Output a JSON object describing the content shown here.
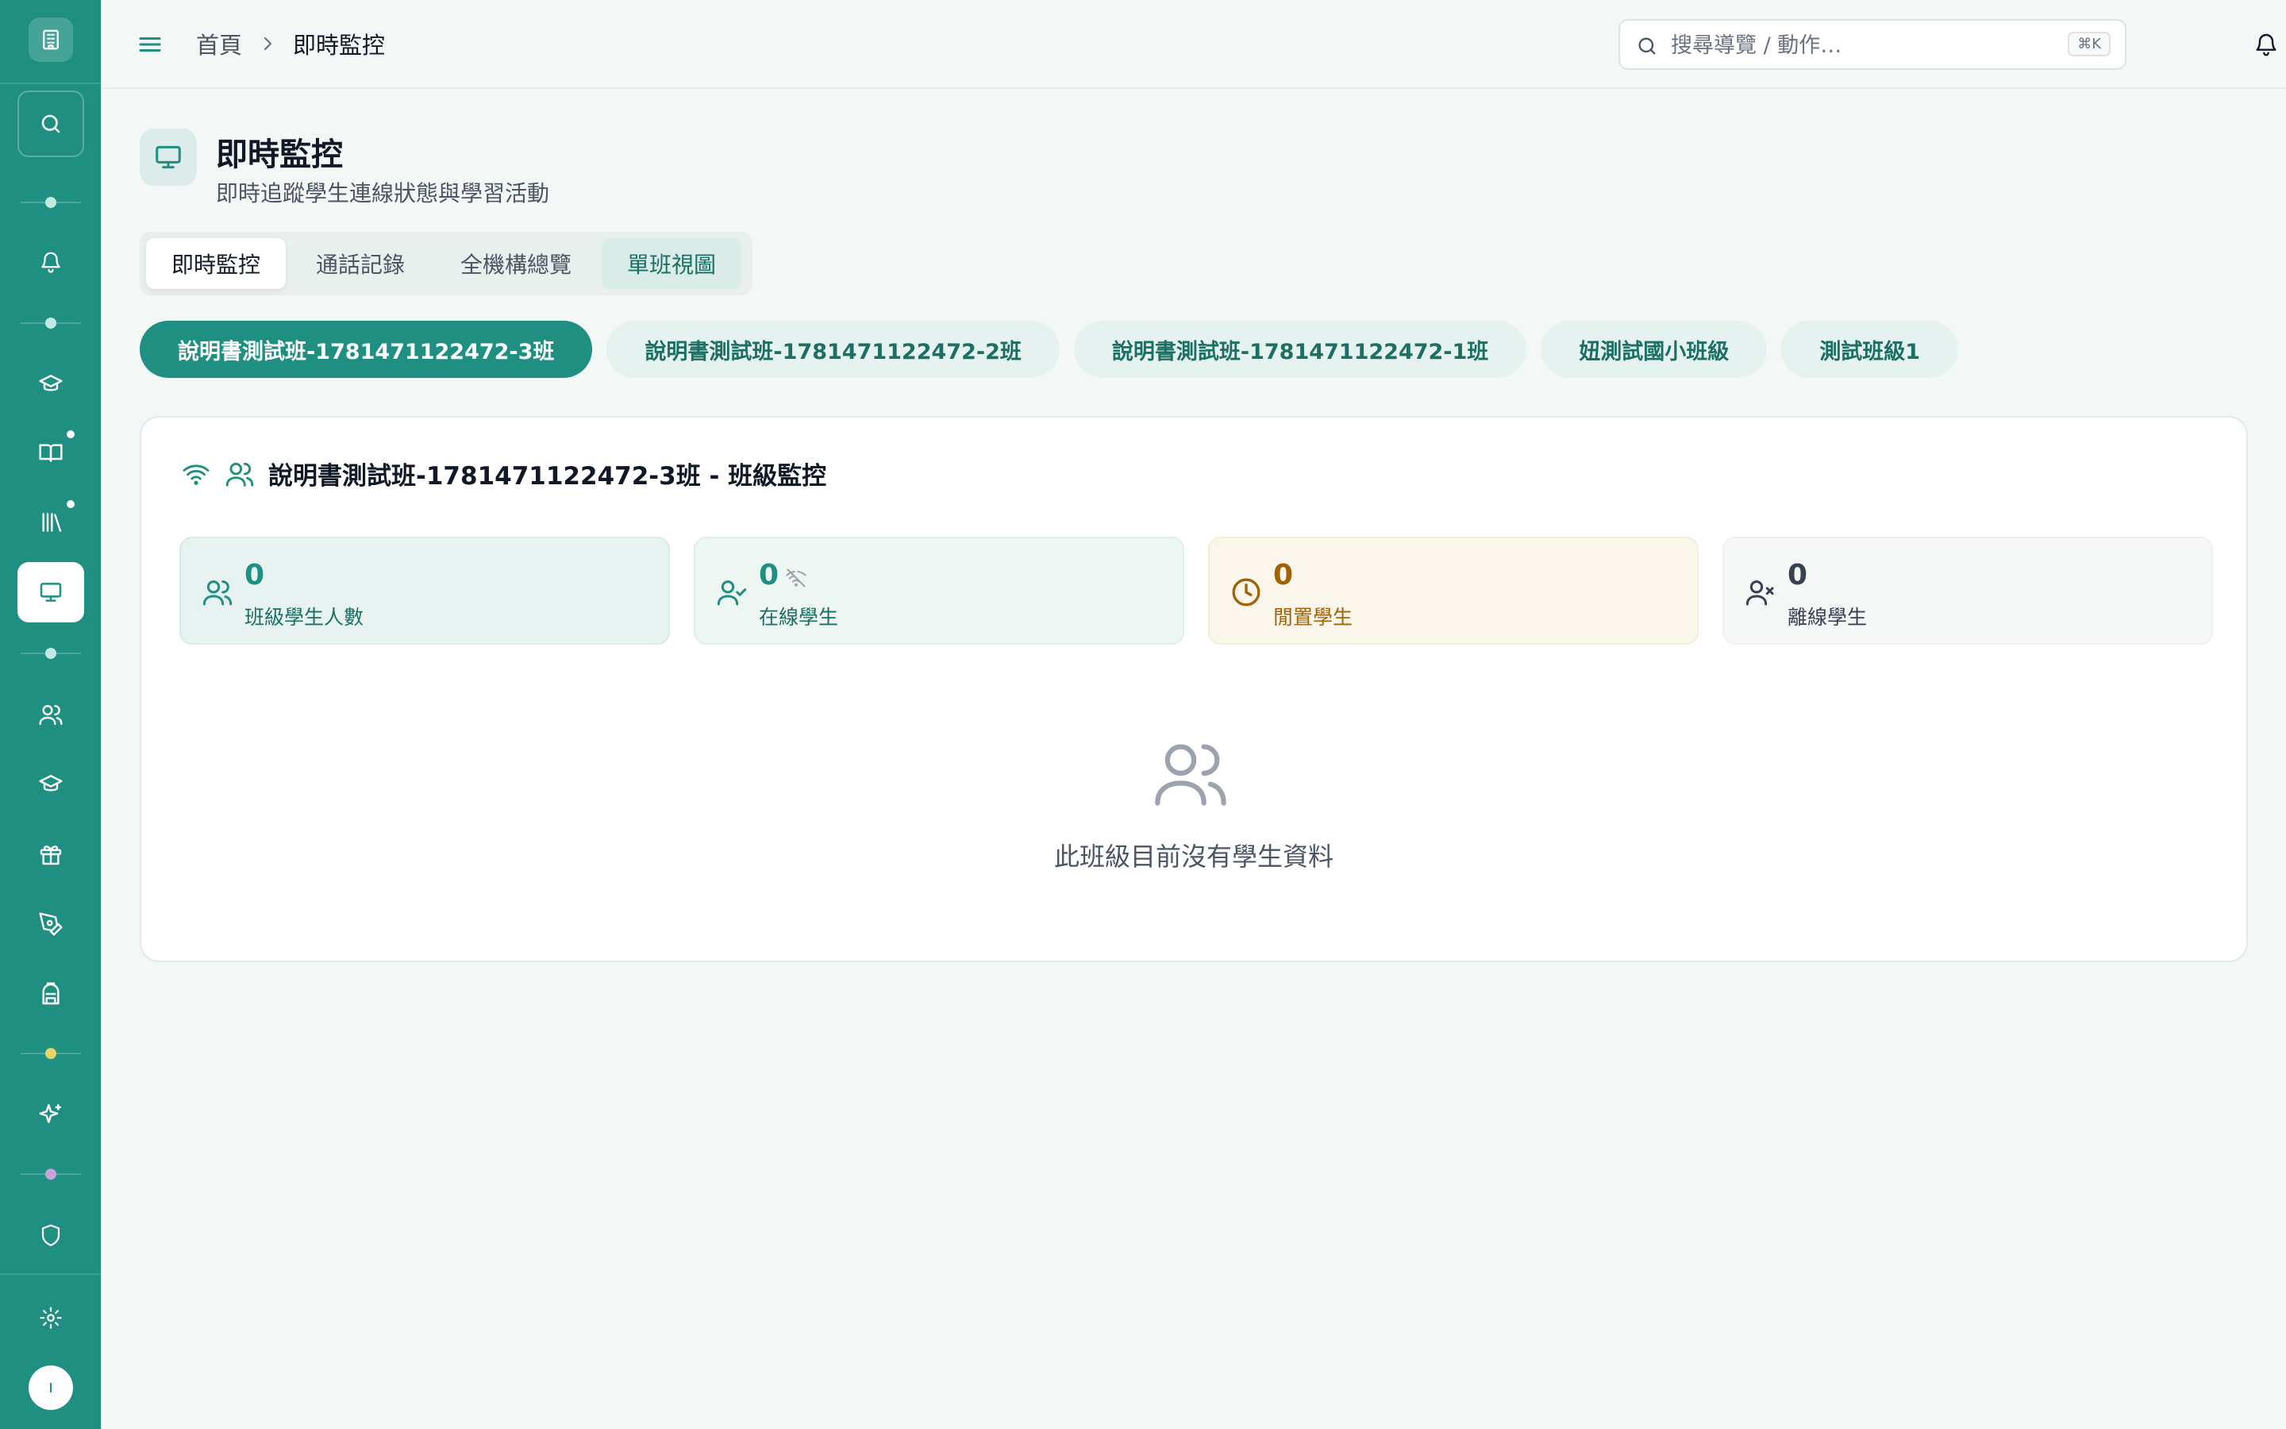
{
  "breadcrumb": {
    "home": "首頁",
    "current": "即時監控"
  },
  "search": {
    "placeholder": "搜尋導覽 / 動作…",
    "shortcut": "⌘K"
  },
  "page": {
    "title": "即時監控",
    "subtitle": "即時追蹤學生連線狀態與學習活動"
  },
  "tabs": [
    {
      "label": "即時監控"
    },
    {
      "label": "通話記錄"
    },
    {
      "label": "全機構總覽"
    },
    {
      "label": "單班視圖"
    }
  ],
  "classes": [
    {
      "label": "說明書測試班-1781471122472-3班"
    },
    {
      "label": "說明書測試班-1781471122472-2班"
    },
    {
      "label": "說明書測試班-1781471122472-1班"
    },
    {
      "label": "妞測試國小班級"
    },
    {
      "label": "測試班級1"
    }
  ],
  "monitor": {
    "title": "說明書測試班-1781471122472-3班 - 班級監控",
    "stats": [
      {
        "value": "0",
        "label": "班級學生人數"
      },
      {
        "value": "0",
        "label": "在線學生"
      },
      {
        "value": "0",
        "label": "閒置學生"
      },
      {
        "value": "0",
        "label": "離線學生"
      }
    ],
    "empty_text": "此班級目前沒有學生資料"
  },
  "colors": {
    "sidebar": "#1e8f80",
    "accent": "#1e8f80",
    "idle": "#a16207",
    "offline": "#374151"
  },
  "icons": {
    "sidebar": [
      "logo-building-icon",
      "search-icon",
      "bell-icon",
      "graduation-cap-icon",
      "book-icon",
      "library-icon",
      "monitor-icon",
      "users-icon",
      "graduation-cap-icon",
      "gift-icon",
      "pen-tool-icon",
      "backpack-icon",
      "sparkles-icon",
      "shield-icon",
      "settings-icon",
      "avatar"
    ]
  }
}
